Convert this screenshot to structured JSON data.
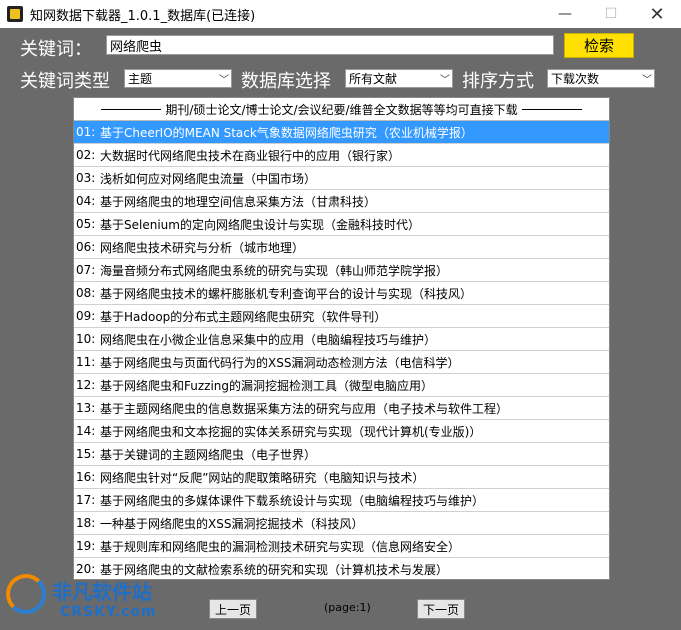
{
  "window": {
    "title": "知网数据下载器_1.0.1_数据库(已连接)",
    "min_icon": "—",
    "max_icon": "☐",
    "close_icon": "✕"
  },
  "search": {
    "label": "关键词：",
    "value": "网络爬虫",
    "button": "检索"
  },
  "filters": {
    "type_label": "关键词类型",
    "type_value": "主题",
    "db_label": "数据库选择",
    "db_value": "所有文献",
    "sort_label": "排序方式",
    "sort_value": "下载次数",
    "chevron": "﹀"
  },
  "list": {
    "header": "期刊/硕士论文/博士论文/会议纪要/维普全文数据等等均可直接下载",
    "selected_index": 0,
    "items": [
      {
        "num": "01:",
        "text": "基于CheerIO的MEAN Stack气象数据网络爬虫研究（农业机械学报）"
      },
      {
        "num": "02:",
        "text": "大数据时代网络爬虫技术在商业银行中的应用（银行家）"
      },
      {
        "num": "03:",
        "text": "浅析如何应对网络爬虫流量（中国市场）"
      },
      {
        "num": "04:",
        "text": "基于网络爬虫的地理空间信息采集方法（甘肃科技）"
      },
      {
        "num": "05:",
        "text": "基于Selenium的定向网络爬虫设计与实现（金融科技时代）"
      },
      {
        "num": "06:",
        "text": "网络爬虫技术研究与分析（城市地理）"
      },
      {
        "num": "07:",
        "text": "海量音频分布式网络爬虫系统的研究与实现（韩山师范学院学报）"
      },
      {
        "num": "08:",
        "text": "基于网络爬虫技术的螺杆膨胀机专利查询平台的设计与实现（科技风）"
      },
      {
        "num": "09:",
        "text": "基于Hadoop的分布式主题网络爬虫研究（软件导刊）"
      },
      {
        "num": "10:",
        "text": "网络爬虫在小微企业信息采集中的应用（电脑编程技巧与维护）"
      },
      {
        "num": "11:",
        "text": "基于网络爬虫与页面代码行为的XSS漏洞动态检测方法（电信科学）"
      },
      {
        "num": "12:",
        "text": "基于网络爬虫和Fuzzing的漏洞挖掘检测工具（微型电脑应用）"
      },
      {
        "num": "13:",
        "text": "基于主题网络爬虫的信息数据采集方法的研究与应用（电子技术与软件工程）"
      },
      {
        "num": "14:",
        "text": "基于网络爬虫和文本挖掘的实体关系研究与实现（现代计算机(专业版)）"
      },
      {
        "num": "15:",
        "text": "基于关键词的主题网络爬虫（电子世界）"
      },
      {
        "num": "16:",
        "text": "网络爬虫针对“反爬”网站的爬取策略研究（电脑知识与技术）"
      },
      {
        "num": "17:",
        "text": "基于网络爬虫的多媒体课件下载系统设计与实现（电脑编程技巧与维护）"
      },
      {
        "num": "18:",
        "text": "一种基于网络爬虫的XSS漏洞挖掘技术（科技风）"
      },
      {
        "num": "19:",
        "text": "基于规则库和网络爬虫的漏洞检测技术研究与实现（信息网络安全）"
      },
      {
        "num": "20:",
        "text": "基于网络爬虫的文献检索系统的研究和实现（计算机技术与发展）"
      }
    ]
  },
  "pagination": {
    "prev": "上一页",
    "page": "(page:1)",
    "next": "下一页"
  },
  "watermark": {
    "cn": "非凡软件站",
    "en": "CRSKY.com"
  }
}
